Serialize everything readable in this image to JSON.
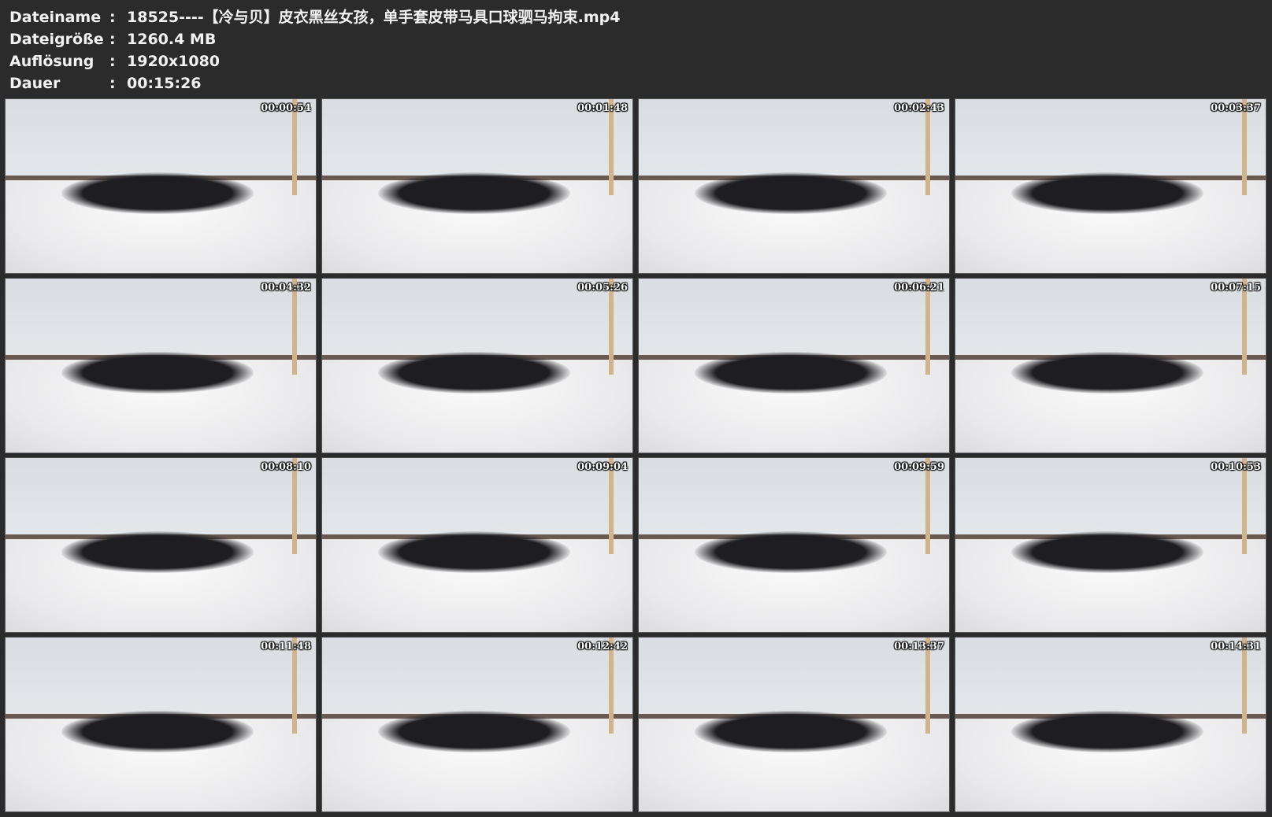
{
  "info": {
    "rows": [
      {
        "label": "Dateiname",
        "colon": ":",
        "value": "18525----【冷与贝】皮衣黑丝女孩，单手套皮带马具口球驷马拘束.mp4"
      },
      {
        "label": "Dateigröße",
        "colon": ":",
        "value": "1260.4 MB"
      },
      {
        "label": "Auflösung",
        "colon": ":",
        "value": "1920x1080"
      },
      {
        "label": "Dauer",
        "colon": ":",
        "value": "00:15:26"
      }
    ]
  },
  "thumbnails": [
    {
      "time": "00:00:54"
    },
    {
      "time": "00:01:48"
    },
    {
      "time": "00:02:43"
    },
    {
      "time": "00:03:37"
    },
    {
      "time": "00:04:32"
    },
    {
      "time": "00:05:26"
    },
    {
      "time": "00:06:21"
    },
    {
      "time": "00:07:15"
    },
    {
      "time": "00:08:10"
    },
    {
      "time": "00:09:04"
    },
    {
      "time": "00:09:59"
    },
    {
      "time": "00:10:53"
    },
    {
      "time": "00:11:48"
    },
    {
      "time": "00:12:42"
    },
    {
      "time": "00:13:37"
    },
    {
      "time": "00:14:31"
    }
  ]
}
